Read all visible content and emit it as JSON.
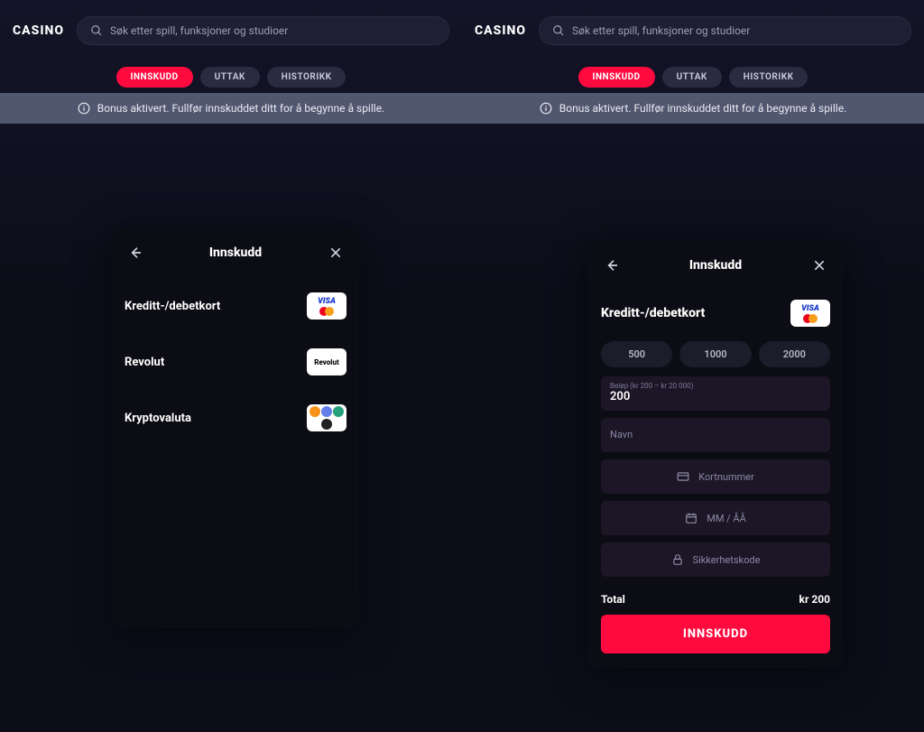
{
  "brand": "CASINO",
  "search_placeholder": "Søk etter spill, funksjoner og studioer",
  "tabs": {
    "deposit": "INNSKUDD",
    "withdraw": "UTTAK",
    "history": "HISTORIKK"
  },
  "banner": "Bonus aktivert. Fullfør innskuddet ditt for å begynne å spille.",
  "modal_left": {
    "title": "Innskudd",
    "methods": {
      "card": "Kreditt-/debetkort",
      "revolut": "Revolut",
      "crypto": "Kryptovaluta"
    }
  },
  "modal_right": {
    "title": "Innskudd",
    "card_label": "Kreditt-/debetkort",
    "amounts": [
      "500",
      "1000",
      "2000"
    ],
    "amount_field": {
      "label": "Beløp (kr 200 – kr 20 000)",
      "value": "200"
    },
    "name_ph": "Navn",
    "cardno_ph": "Kortnummer",
    "exp_ph": "MM / ÅÅ",
    "cvv_ph": "Sikkerhetskode",
    "total_label": "Total",
    "total_value": "kr 200",
    "submit": "INNSKUDD"
  }
}
